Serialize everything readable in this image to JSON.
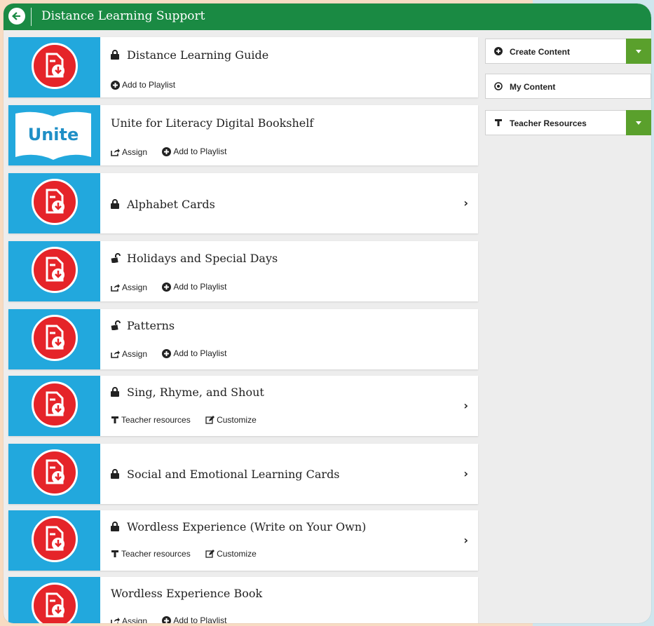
{
  "header": {
    "title": "Distance Learning Support"
  },
  "items": [
    {
      "title": "Distance Learning Guide",
      "actions": [
        "Add to Playlist"
      ]
    },
    {
      "title": "Unite for Literacy Digital Bookshelf",
      "thumb_text": "Unite",
      "actions": [
        "Assign",
        "Add to Playlist"
      ]
    },
    {
      "title": "Alphabet Cards"
    },
    {
      "title": "Holidays and Special Days",
      "actions": [
        "Assign",
        "Add to Playlist"
      ]
    },
    {
      "title": "Patterns",
      "actions": [
        "Assign",
        "Add to Playlist"
      ]
    },
    {
      "title": "Sing, Rhyme, and Shout",
      "actions": [
        "Teacher resources",
        "Customize"
      ]
    },
    {
      "title": "Social and Emotional Learning Cards"
    },
    {
      "title": "Wordless Experience (Write on Your Own)",
      "actions": [
        "Teacher resources",
        "Customize"
      ]
    },
    {
      "title": "Wordless Experience Book",
      "actions": [
        "Assign",
        "Add to Playlist"
      ]
    }
  ],
  "sidebar": {
    "create_content": "Create Content",
    "my_content": "My Content",
    "teacher_resources": "Teacher Resources"
  },
  "colors": {
    "header": "#1a8a43",
    "thumb_blue": "#22a8dd",
    "icon_red": "#e52429",
    "dropdown_green": "#5aa02c"
  }
}
